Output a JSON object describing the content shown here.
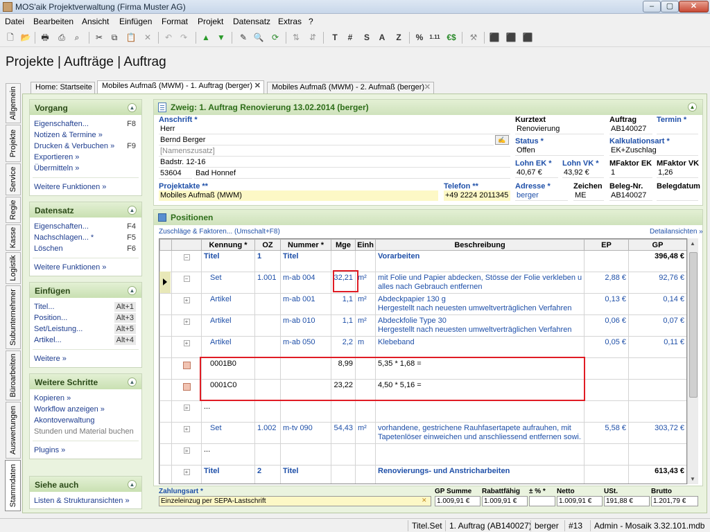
{
  "window": {
    "title": "MOS'aik Projektverwaltung (Firma Muster AG)",
    "btn_min": "–",
    "btn_max": "▢",
    "btn_close": "✕"
  },
  "menu": [
    "Datei",
    "Bearbeiten",
    "Ansicht",
    "Einfügen",
    "Format",
    "Projekt",
    "Datensatz",
    "Extras",
    "?"
  ],
  "toolbar_text": {
    "t": "T",
    "hash": "#",
    "s": "S",
    "a": "A",
    "z": "Z",
    "percent": "%",
    "nums": "1.11",
    "euro": "€$"
  },
  "page_header": "Projekte | Aufträge | Auftrag",
  "vtabs": [
    "Allgemein",
    "Projekte",
    "Service",
    "Regie",
    "Kasse",
    "Logistik",
    "Subunternehmer",
    "Büroarbeiten",
    "Auswertungen",
    "Stammdaten"
  ],
  "tabs": [
    "Home: Startseite",
    "Mobiles Aufmaß (MWM) - 1. Auftrag (berger)",
    "Mobiles Aufmaß (MWM) - 2. Aufmaß (berger)"
  ],
  "left": {
    "vorgang": {
      "title": "Vorgang",
      "items": [
        {
          "label": "Eigenschaften...",
          "key": "F8"
        },
        {
          "label": "Notizen & Termine »",
          "key": ""
        },
        {
          "label": "Drucken & Verbuchen »",
          "key": "F9"
        },
        {
          "label": "Exportieren »",
          "key": ""
        },
        {
          "label": "Übermitteln »",
          "key": ""
        }
      ],
      "more": "Weitere Funktionen »"
    },
    "datensatz": {
      "title": "Datensatz",
      "items": [
        {
          "label": "Eigenschaften...",
          "key": "F4"
        },
        {
          "label": "Nachschlagen... *",
          "key": "F5"
        },
        {
          "label": "Löschen",
          "key": "F6"
        }
      ],
      "more": "Weitere Funktionen »"
    },
    "einfuegen": {
      "title": "Einfügen",
      "items": [
        {
          "label": "Titel...",
          "key": "Alt+1"
        },
        {
          "label": "Position...",
          "key": "Alt+3"
        },
        {
          "label": "Set/Leistung...",
          "key": "Alt+5"
        },
        {
          "label": "Artikel...",
          "key": "Alt+4"
        }
      ],
      "more": "Weitere »"
    },
    "schritte": {
      "title": "Weitere Schritte",
      "items": [
        "Kopieren »",
        "Workflow anzeigen »",
        "Akontoverwaltung",
        "Stunden und Material buchen"
      ],
      "more": "Plugins »"
    },
    "siehe": {
      "title": "Siehe auch",
      "items": [
        "Listen & Strukturansichten »"
      ]
    }
  },
  "zweig": {
    "title": "Zweig: 1. Auftrag Renovierung 13.02.2014 (berger)",
    "anschrift_label": "Anschrift *",
    "anrede": "Herr",
    "name": "Bernd Berger",
    "zusatz": "[Namenszusatz]",
    "strasse": "Badstr. 12-16",
    "plz": "53604",
    "ort": "Bad Honnef",
    "projektakte_label": "Projektakte **",
    "projektakte": "Mobiles Aufmaß (MWM)",
    "telefon_label": "Telefon **",
    "telefon": "+49 2224 2011345",
    "kurztext_label": "Kurztext",
    "kurztext": "Renovierung",
    "auftrag_label": "Auftrag",
    "auftrag": "AB140027",
    "termin_label": "Termin *",
    "status_label": "Status *",
    "status": "Offen",
    "kalk_label": "Kalkulationsart *",
    "kalk": "EK+Zuschlag",
    "lohnek_label": "Lohn EK *",
    "lohnek": "40,67 €",
    "lohnvk_label": "Lohn VK *",
    "lohnvk": "43,92 €",
    "mfek_label": "MFaktor EK",
    "mfek": "1",
    "mfvk_label": "MFaktor VK",
    "mfvk": "1,26",
    "adresse_label": "Adresse *",
    "adresse": "berger",
    "zeichen_label": "Zeichen",
    "zeichen": "ME",
    "belegnr_label": "Beleg-Nr.",
    "belegnr": "AB140027",
    "belegdatum_label": "Belegdatum"
  },
  "positionen": {
    "title": "Positionen",
    "zuschlaege": "Zuschläge & Faktoren... (Umschalt+F8)",
    "detail": "Detailansichten »",
    "columns": [
      "Kennung *",
      "OZ",
      "Nummer *",
      "Mge",
      "Einh",
      "Beschreibung",
      "EP",
      "GP"
    ],
    "rows": [
      {
        "kennung": "Titel",
        "oz": "1",
        "nummer": "Titel",
        "mge": "",
        "einh": "",
        "beschr1": "Vorarbeiten",
        "beschr2": "",
        "ep": "",
        "gp": "396,48 €",
        "bold": true,
        "tree": "-"
      },
      {
        "kennung": "Set",
        "oz": "1.001",
        "nummer": "m-ab 004",
        "mge": "32,21",
        "einh": "m²",
        "beschr1": "mit Folie und Papier abdecken, Stösse der Folie verkleben und",
        "beschr2": "alles nach Gebrauch entfernen",
        "ep": "2,88 €",
        "gp": "92,76 €",
        "bold": false,
        "tree": "-"
      },
      {
        "kennung": "Artikel",
        "oz": "",
        "nummer": "m-ab 001",
        "mge": "1,1",
        "einh": "m²",
        "beschr1": "Abdeckpapier 130 g",
        "beschr2": "Hergestellt nach neuesten umweltverträglichen Verfahren",
        "ep": "0,13 €",
        "gp": "0,14 €",
        "bold": false,
        "tree": "+"
      },
      {
        "kennung": "Artikel",
        "oz": "",
        "nummer": "m-ab 010",
        "mge": "1,1",
        "einh": "m²",
        "beschr1": "Abdeckfolie Type 30",
        "beschr2": "Hergestellt nach neuesten umweltverträglichen Verfahren",
        "ep": "0,06 €",
        "gp": "0,07 €",
        "bold": false,
        "tree": "+"
      },
      {
        "kennung": "Artikel",
        "oz": "",
        "nummer": "m-ab 050",
        "mge": "2,2",
        "einh": "m",
        "beschr1": "Klebeband",
        "beschr2": "",
        "ep": "0,05 €",
        "gp": "0,11 €",
        "bold": false,
        "tree": "+"
      },
      {
        "kennung": "0001B0",
        "oz": "",
        "nummer": "",
        "mge": "8,99",
        "einh": "",
        "beschr1": "5,35 * 1,68 =",
        "beschr2": "",
        "ep": "",
        "gp": "",
        "bold": false,
        "tree": "sq"
      },
      {
        "kennung": "0001C0",
        "oz": "",
        "nummer": "",
        "mge": "23,22",
        "einh": "",
        "beschr1": "4,50 * 5,16 =",
        "beschr2": "",
        "ep": "",
        "gp": "",
        "bold": false,
        "tree": "sq"
      },
      {
        "kennung": "...",
        "oz": "",
        "nummer": "",
        "mge": "",
        "einh": "",
        "beschr1": "",
        "beschr2": "",
        "ep": "",
        "gp": "",
        "bold": false,
        "tree": "»"
      },
      {
        "kennung": "Set",
        "oz": "1.002",
        "nummer": "m-tv 090",
        "mge": "54,43",
        "einh": "m²",
        "beschr1": "vorhandene, gestrichene Rauhfasertapete aufrauhen, mit",
        "beschr2": "Tapetenlöser einweichen und anschliessend entfernen sowi...",
        "ep": "5,58 €",
        "gp": "303,72 €",
        "bold": false,
        "tree": "+"
      },
      {
        "kennung": "...",
        "oz": "",
        "nummer": "",
        "mge": "",
        "einh": "",
        "beschr1": "",
        "beschr2": "",
        "ep": "",
        "gp": "",
        "bold": false,
        "tree": "»"
      },
      {
        "kennung": "Titel",
        "oz": "2",
        "nummer": "Titel",
        "mge": "",
        "einh": "",
        "beschr1": "Renovierungs- und Anstricharbeiten",
        "beschr2": "",
        "ep": "",
        "gp": "613,43 €",
        "bold": true,
        "tree": "+"
      }
    ]
  },
  "summary": {
    "zahlungsart_label": "Zahlungsart *",
    "zahlungsart": "Einzeleinzug per SEPA-Lastschrift",
    "gpsumme_label": "GP Summe",
    "gpsumme": "1.009,91 €",
    "rabatt_label": "Rabattfähig",
    "rabatt": "1.009,91 €",
    "pct_label": "± % *",
    "pct": "",
    "netto_label": "Netto",
    "netto": "1.009,91 €",
    "ust_label": "USt.",
    "ust": "191,88 €",
    "brutto_label": "Brutto",
    "brutto": "1.201,79 €"
  },
  "status": [
    "Titel.Set",
    "1. Auftrag (AB140027)",
    "berger",
    "#13",
    "Admin - Mosaik 3.32.101.mdb"
  ]
}
